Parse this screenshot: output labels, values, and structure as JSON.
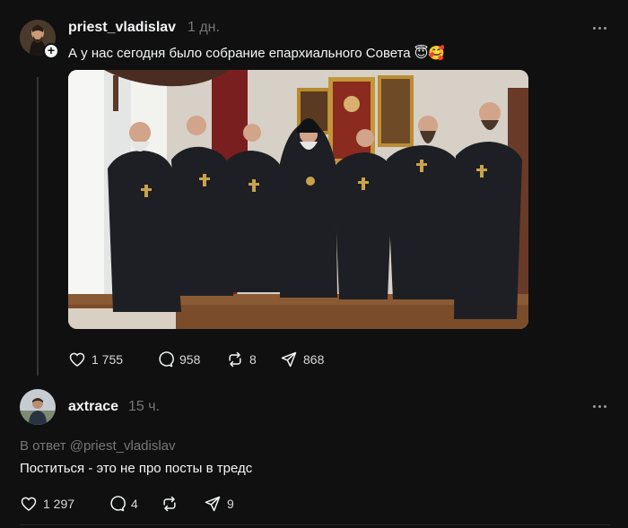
{
  "post1": {
    "author": "priest_vladislav",
    "time": "1 дн.",
    "text": "А у нас сегодня было собрание епархиального Совета 😇🥰",
    "stats": {
      "likes": "1 755",
      "comments": "958",
      "reposts": "8",
      "shares": "868"
    }
  },
  "post2": {
    "author": "axtrace",
    "time": "15 ч.",
    "reply_to": "В ответ @priest_vladislav",
    "text": "Поститься - это не про посты в тредс",
    "stats": {
      "likes": "1 297",
      "comments": "4",
      "reposts": "",
      "shares": "9"
    }
  },
  "colors": {
    "background": "#101010",
    "text": "#f3f5f7",
    "muted": "#777777",
    "thread_line": "#333638"
  },
  "icons": [
    "heart-icon",
    "comment-icon",
    "repost-icon",
    "share-icon",
    "more-icon",
    "plus-icon"
  ]
}
